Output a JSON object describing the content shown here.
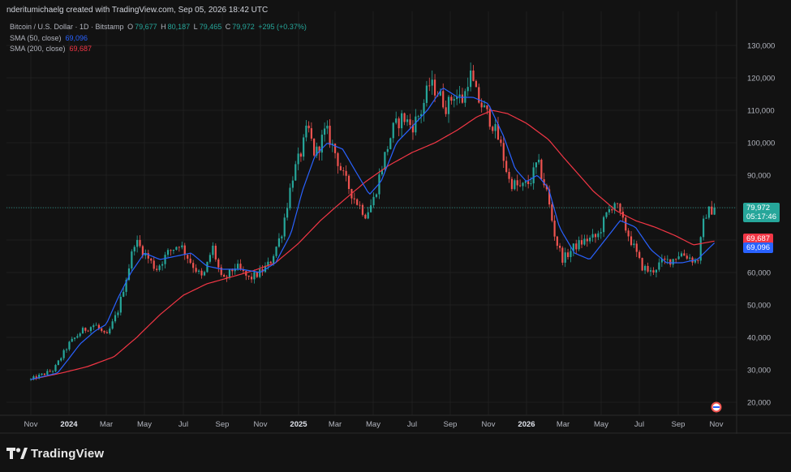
{
  "header": {
    "attribution": "nderitumichaelg created with TradingView.com, Sep 05, 2026 18:42 UTC"
  },
  "legend": {
    "symbol": "Bitcoin / U.S. Dollar · 1D · Bitstamp",
    "open_label": "O",
    "open": "79,677",
    "high_label": "H",
    "high": "80,187",
    "low_label": "L",
    "low": "79,465",
    "close_label": "C",
    "close": "79,972",
    "change": "+295 (+0.37%)",
    "sma50_label": "SMA (50, close)",
    "sma50_value": "69,096",
    "sma200_label": "SMA (200, close)",
    "sma200_value": "69,687"
  },
  "price_tags": {
    "last_price": "79,972",
    "countdown": "05:17:46",
    "sma200": "69,687",
    "sma50": "69,096"
  },
  "footer": {
    "brand": "TradingView"
  },
  "colors": {
    "up": "#26a69a",
    "down": "#ef5350",
    "sma50": "#2962ff",
    "sma200": "#f23645",
    "background": "#121212",
    "grid": "#1f1f1f"
  },
  "chart_data": {
    "type": "candlestick",
    "ylim": [
      15000,
      135000
    ],
    "y_ticks": [
      20000,
      30000,
      40000,
      50000,
      60000,
      70000,
      80000,
      90000,
      100000,
      110000,
      120000,
      130000
    ],
    "y_tick_labels": [
      "20,000",
      "30,000",
      "40,000",
      "50,000",
      "60,000",
      "70,000",
      "80,000",
      "90,000",
      "100,000",
      "110,000",
      "120,000",
      "130,000"
    ],
    "x_ticks": [
      0,
      1,
      2,
      3,
      4,
      5,
      6,
      7,
      8,
      9,
      10,
      11,
      12,
      13,
      14,
      15,
      16,
      17,
      18,
      19
    ],
    "x_tick_labels": [
      "Nov",
      "2024",
      "Mar",
      "May",
      "Jul",
      "Sep",
      "Nov",
      "2025",
      "Mar",
      "May",
      "Jul",
      "Sep",
      "Nov",
      "2026",
      "Mar",
      "May",
      "Jul",
      "Sep",
      "Nov"
    ],
    "x_tick_bold": [
      false,
      true,
      false,
      false,
      false,
      false,
      false,
      true,
      false,
      false,
      false,
      false,
      false,
      true,
      false,
      false,
      false,
      false,
      false
    ],
    "price_anchors": [
      [
        0,
        27000
      ],
      [
        0.6,
        30000
      ],
      [
        1,
        38000
      ],
      [
        1.35,
        42000
      ],
      [
        1.7,
        44000
      ],
      [
        2.0,
        40000
      ],
      [
        2.3,
        48000
      ],
      [
        2.6,
        62000
      ],
      [
        2.75,
        70000
      ],
      [
        3.0,
        66000
      ],
      [
        3.3,
        61000
      ],
      [
        3.6,
        66000
      ],
      [
        3.9,
        69000
      ],
      [
        4.2,
        63000
      ],
      [
        4.5,
        58000
      ],
      [
        4.75,
        68000
      ],
      [
        5.0,
        57000
      ],
      [
        5.35,
        62000
      ],
      [
        5.7,
        58000
      ],
      [
        6.0,
        60000
      ],
      [
        6.25,
        63000
      ],
      [
        6.55,
        72000
      ],
      [
        6.85,
        90000
      ],
      [
        7.1,
        98000
      ],
      [
        7.25,
        105000
      ],
      [
        7.45,
        96000
      ],
      [
        7.75,
        104000
      ],
      [
        8.0,
        97000
      ],
      [
        8.2,
        90000
      ],
      [
        8.5,
        83000
      ],
      [
        8.8,
        78000
      ],
      [
        9.0,
        82000
      ],
      [
        9.25,
        94000
      ],
      [
        9.5,
        104000
      ],
      [
        9.75,
        108000
      ],
      [
        10.0,
        105000
      ],
      [
        10.25,
        110000
      ],
      [
        10.45,
        118000
      ],
      [
        10.65,
        116000
      ],
      [
        10.9,
        111000
      ],
      [
        11.1,
        115000
      ],
      [
        11.35,
        113000
      ],
      [
        11.5,
        122000
      ],
      [
        11.7,
        114000
      ],
      [
        11.9,
        110000
      ],
      [
        12.1,
        106000
      ],
      [
        12.3,
        100000
      ],
      [
        12.55,
        88000
      ],
      [
        12.85,
        86000
      ],
      [
        13.1,
        88000
      ],
      [
        13.3,
        94000
      ],
      [
        13.55,
        85000
      ],
      [
        13.8,
        70000
      ],
      [
        14.0,
        64000
      ],
      [
        14.3,
        68000
      ],
      [
        14.6,
        70000
      ],
      [
        14.9,
        71000
      ],
      [
        15.15,
        78000
      ],
      [
        15.35,
        82000
      ],
      [
        15.55,
        76000
      ],
      [
        15.85,
        68000
      ],
      [
        16.05,
        62000
      ],
      [
        16.3,
        60000
      ],
      [
        16.55,
        63000
      ],
      [
        16.85,
        64000
      ],
      [
        17.05,
        66000
      ],
      [
        17.25,
        65000
      ],
      [
        17.5,
        63000
      ],
      [
        17.7,
        78000
      ],
      [
        17.95,
        80000
      ]
    ],
    "sma50_anchors": [
      [
        0,
        27000
      ],
      [
        0.7,
        29000
      ],
      [
        1.3,
        38000
      ],
      [
        1.7,
        42000
      ],
      [
        2.0,
        44000
      ],
      [
        2.3,
        52000
      ],
      [
        2.65,
        60000
      ],
      [
        3.0,
        66000
      ],
      [
        3.4,
        64000
      ],
      [
        3.8,
        65000
      ],
      [
        4.2,
        66000
      ],
      [
        4.6,
        62000
      ],
      [
        5.0,
        61000
      ],
      [
        5.5,
        61000
      ],
      [
        6.0,
        60000
      ],
      [
        6.4,
        63000
      ],
      [
        6.8,
        72000
      ],
      [
        7.1,
        85000
      ],
      [
        7.45,
        96000
      ],
      [
        7.8,
        100000
      ],
      [
        8.2,
        98000
      ],
      [
        8.6,
        90000
      ],
      [
        8.9,
        84000
      ],
      [
        9.2,
        88000
      ],
      [
        9.6,
        100000
      ],
      [
        10.0,
        105000
      ],
      [
        10.4,
        110000
      ],
      [
        10.8,
        117000
      ],
      [
        11.2,
        114000
      ],
      [
        11.6,
        114000
      ],
      [
        12.0,
        112000
      ],
      [
        12.4,
        102000
      ],
      [
        12.7,
        92000
      ],
      [
        13.0,
        88000
      ],
      [
        13.3,
        90000
      ],
      [
        13.6,
        86000
      ],
      [
        13.9,
        74000
      ],
      [
        14.3,
        66000
      ],
      [
        14.7,
        64000
      ],
      [
        15.1,
        70000
      ],
      [
        15.5,
        76000
      ],
      [
        15.9,
        74000
      ],
      [
        16.3,
        67000
      ],
      [
        16.7,
        63000
      ],
      [
        17.1,
        63000
      ],
      [
        17.5,
        64000
      ],
      [
        17.95,
        69096
      ]
    ],
    "sma200_anchors": [
      [
        0,
        27000
      ],
      [
        0.8,
        29000
      ],
      [
        1.5,
        31000
      ],
      [
        2.2,
        34000
      ],
      [
        2.8,
        40000
      ],
      [
        3.4,
        47000
      ],
      [
        4.0,
        53000
      ],
      [
        4.6,
        56500
      ],
      [
        5.2,
        58500
      ],
      [
        5.8,
        60500
      ],
      [
        6.4,
        63000
      ],
      [
        7.0,
        69000
      ],
      [
        7.6,
        76000
      ],
      [
        8.2,
        82000
      ],
      [
        8.8,
        88000
      ],
      [
        9.4,
        93000
      ],
      [
        10.0,
        97000
      ],
      [
        10.6,
        100000
      ],
      [
        11.2,
        104000
      ],
      [
        11.7,
        108000
      ],
      [
        12.1,
        110000
      ],
      [
        12.5,
        109000
      ],
      [
        13.0,
        106000
      ],
      [
        13.6,
        101000
      ],
      [
        14.2,
        93000
      ],
      [
        14.8,
        85000
      ],
      [
        15.4,
        79000
      ],
      [
        15.9,
        76000
      ],
      [
        16.4,
        74000
      ],
      [
        16.9,
        71500
      ],
      [
        17.4,
        68500
      ],
      [
        17.95,
        69687
      ]
    ],
    "last_price": 79972,
    "sma50_last": 69096,
    "sma200_last": 69687
  }
}
